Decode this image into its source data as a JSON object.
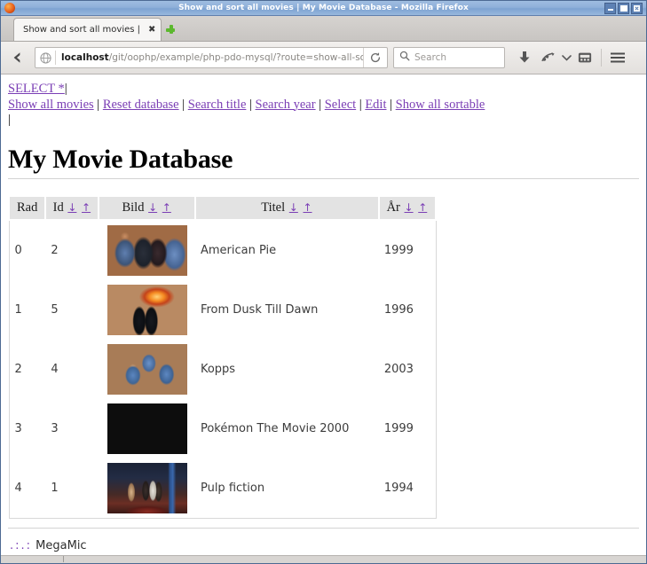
{
  "window": {
    "title": "Show and sort all movies | My Movie Database - Mozilla Firefox",
    "controls": {
      "minimize": "minimize-button",
      "maximize": "maximize-button",
      "close": "close-button"
    }
  },
  "tabs": [
    {
      "label": "Show and sort all movies | ...",
      "close_label": "✖"
    }
  ],
  "new_tab_label": "+",
  "toolbar": {
    "back_label": "Back",
    "url_host": "localhost",
    "url_path": "/git/oophp/example/php-pdo-mysql/?route=show-all-sor",
    "reload_label": "Reload",
    "search_placeholder": "Search",
    "icons": [
      "download-icon",
      "sync-icon",
      "chevron-down-icon",
      "reader-icon",
      "hamburger-menu-icon"
    ]
  },
  "page": {
    "select_link": "SELECT *",
    "nav_links": [
      "Show all movies",
      "Reset database",
      "Search title",
      "Search year",
      "Select",
      "Edit",
      "Show all sortable"
    ],
    "separator": "|",
    "title": "My Movie Database",
    "footer": {
      "dots": ".:.:",
      "text": "MegaMic"
    }
  },
  "table": {
    "columns": [
      {
        "label": "Rad",
        "sortable": false
      },
      {
        "label": "Id",
        "sortable": true
      },
      {
        "label": "Bild",
        "sortable": true
      },
      {
        "label": "Titel",
        "sortable": true
      },
      {
        "label": "År",
        "sortable": true
      }
    ],
    "sort_desc_glyph": "↓",
    "sort_asc_glyph": "↑",
    "rows": [
      {
        "rad": "0",
        "id": "2",
        "image": "american-pie-thumbnail",
        "image_class": "th-american-pie",
        "titel": "American Pie",
        "ar": "1999"
      },
      {
        "rad": "1",
        "id": "5",
        "image": "from-dusk-till-dawn-thumbnail",
        "image_class": "th-dusk",
        "titel": "From Dusk Till Dawn",
        "ar": "1996"
      },
      {
        "rad": "2",
        "id": "4",
        "image": "kopps-thumbnail",
        "image_class": "th-kopps",
        "titel": "Kopps",
        "ar": "2003"
      },
      {
        "rad": "3",
        "id": "3",
        "image": "pokemon-the-movie-2000-thumbnail",
        "image_class": "th-pokemon",
        "titel": "Pokémon The Movie 2000",
        "ar": "1999"
      },
      {
        "rad": "4",
        "id": "1",
        "image": "pulp-fiction-thumbnail",
        "image_class": "th-pulp",
        "titel": "Pulp fiction",
        "ar": "1994"
      }
    ]
  },
  "colors": {
    "link": "#7b3fb5",
    "titlebar": "#8fb0da",
    "table_header_bg": "#e3e3e3"
  }
}
